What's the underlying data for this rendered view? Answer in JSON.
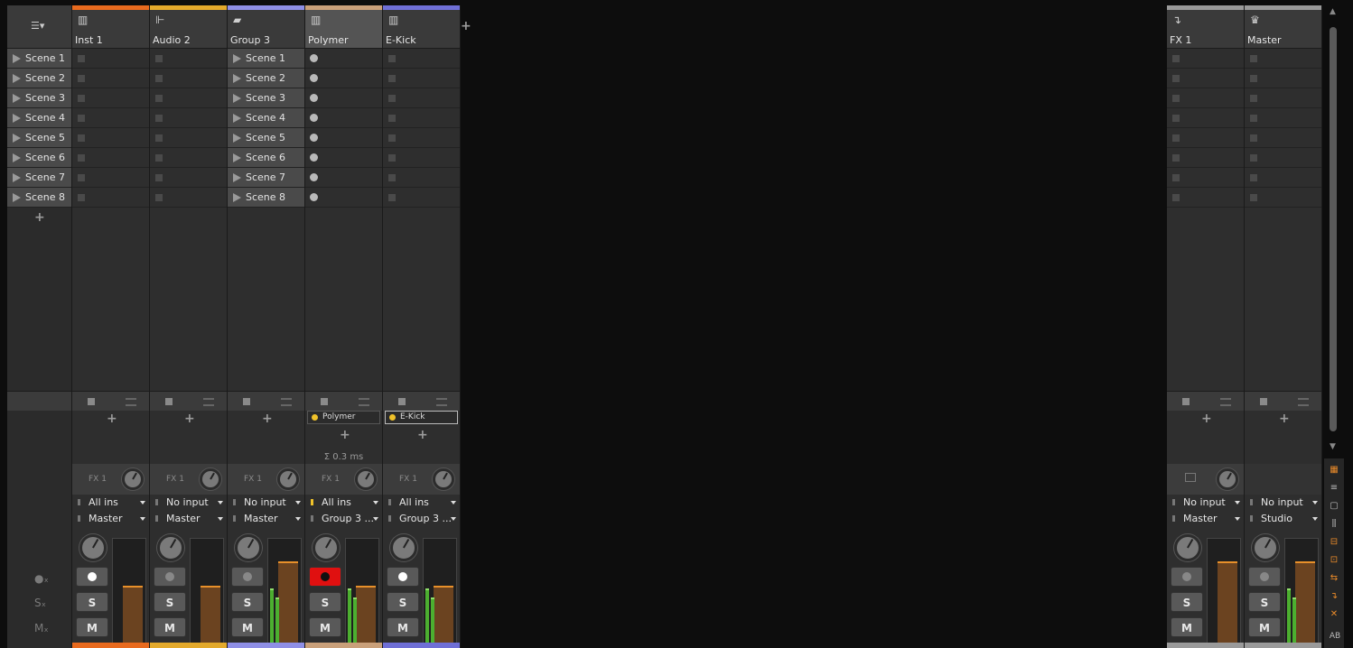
{
  "scenes": [
    "Scene 1",
    "Scene 2",
    "Scene 3",
    "Scene 4",
    "Scene 5",
    "Scene 6",
    "Scene 7",
    "Scene 8"
  ],
  "left_tools": {
    "solo_label": "S",
    "mute_label": "M",
    "add_scene": "+",
    "fx_icon": "ⓧ"
  },
  "tracks": [
    {
      "name": "Inst 1",
      "icon": "piano-icon",
      "icon_glyph": "▥",
      "color": "#e86a1e",
      "clip_style": "square",
      "input": "All ins",
      "output": "Master",
      "send_label": "FX 1",
      "fader_level": 0.55,
      "armed": false,
      "meters": false
    },
    {
      "name": "Audio 2",
      "icon": "waveform-icon",
      "icon_glyph": "⊩",
      "color": "#e3a92b",
      "clip_style": "square",
      "input": "No input",
      "output": "Master",
      "send_label": "FX 1",
      "fader_level": 0.55,
      "armed": false,
      "meters": false
    },
    {
      "name": "Group 3",
      "icon": "folder-icon",
      "icon_glyph": "▰",
      "color": "#8f8fe6",
      "clip_style": "scene",
      "input": "No input",
      "output": "Master",
      "send_label": "FX 1",
      "fader_level": 0.78,
      "armed": false,
      "meters": true
    },
    {
      "name": "Polymer",
      "icon": "piano-icon",
      "icon_glyph": "▥",
      "color": "#c9a07a",
      "clip_style": "dot",
      "input": "All ins",
      "output": "Group 3 ...",
      "send_label": "FX 1",
      "fader_level": 0.55,
      "armed": true,
      "meters": true,
      "device": "Polymer",
      "latency": "Σ 0.3 ms"
    },
    {
      "name": "E-Kick",
      "icon": "piano-icon",
      "icon_glyph": "▥",
      "color": "#6f6fd6",
      "clip_style": "square",
      "input": "All ins",
      "output": "Group 3 ...",
      "send_label": "FX 1",
      "fader_level": 0.55,
      "armed": false,
      "meters": true,
      "device": "E-Kick"
    }
  ],
  "fx_tracks": [
    {
      "name": "FX 1",
      "icon": "return-icon",
      "icon_glyph": "↴",
      "color": "#9a9a9a",
      "input": "No input",
      "output": "Master",
      "fader_level": 0.78,
      "meters": false
    },
    {
      "name": "Master",
      "icon": "crown-icon",
      "icon_glyph": "♛",
      "color": "#9a9a9a",
      "input": "No input",
      "output": "Studio",
      "fader_level": 0.78,
      "meters": true
    }
  ],
  "add_track": "+",
  "button_labels": {
    "solo": "S",
    "mute": "M"
  },
  "right_bar_icons": [
    "clip-launcher-icon",
    "arranger-icon",
    "comment-icon",
    "mixer-icon",
    "io-icon",
    "fx-icon",
    "sends-icon",
    "return-icon",
    "close-icon",
    "ab-icon"
  ],
  "ab_label": "AB"
}
